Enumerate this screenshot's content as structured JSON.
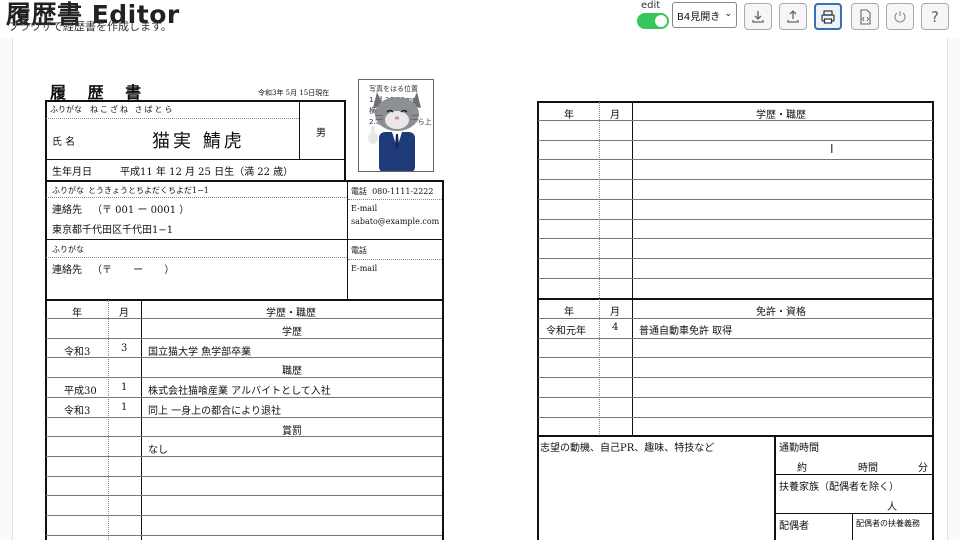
{
  "app": {
    "title": "履歴書 Editor",
    "subtitle": "ブラウザで経歴書を作成します。"
  },
  "toolbar": {
    "edit_label": "edit",
    "edit_on": true,
    "layout_select": "B4見開き",
    "buttons": [
      {
        "name": "download-icon"
      },
      {
        "name": "upload-icon"
      },
      {
        "name": "print-icon"
      },
      {
        "name": "html-code-icon"
      },
      {
        "name": "power-icon"
      },
      {
        "name": "help-icon",
        "label": "?"
      }
    ]
  },
  "resume": {
    "title": "履 歴 書",
    "date": "令和3年 5月 15日現在",
    "photo_text": [
      "写真をはる位置",
      "1.縦 36-40mm",
      "横 24-30mm",
      "2.本人単身胸から上"
    ],
    "furigana_label": "ふりがな",
    "name_furigana": "ねこざね さばとら",
    "name_label": "氏 名",
    "name": "猫実 鯖虎",
    "gender": "男",
    "birth_label": "生年月日",
    "birth": "平成11 年 12 月 25 日生（満 22 歳）",
    "address_furigana": "とうきょうとちよだくちよだ1−1",
    "contact_label": "連絡先",
    "postal": "（〒 001 ー 0001 ）",
    "address": "東京都千代田区千代田1−1",
    "phone_label": "電話",
    "phone": "080-1111-2222",
    "email_label": "E-mail",
    "email": "sabato@example.com",
    "postal2": "（〒 ー ）",
    "col_year": "年",
    "col_month": "月",
    "col_history": "学歴・職歴",
    "history_rows": [
      {
        "year": "",
        "month": "",
        "text": "学歴",
        "center": true
      },
      {
        "year": "令和3",
        "month": "3",
        "text": "国立猫大学 魚学部卒業",
        "center": false
      },
      {
        "year": "",
        "month": "",
        "text": "職歴",
        "center": true
      },
      {
        "year": "平成30",
        "month": "1",
        "text": "株式会社猫喰産業 アルバイトとして入社",
        "center": false
      },
      {
        "year": "令和3",
        "month": "1",
        "text": "同上 一身上の都合により退社",
        "center": false
      },
      {
        "year": "",
        "month": "",
        "text": "賞罰",
        "center": true
      },
      {
        "year": "",
        "month": "",
        "text": "なし",
        "center": false
      }
    ],
    "col_license": "免許・資格",
    "license_rows": [
      {
        "year": "令和元年",
        "month": "4",
        "text": "普通自動車免許 取得"
      }
    ],
    "motivation_label": "志望の動機、自己PR、趣味、特技など",
    "commute_label": "通勤時間",
    "commute_value": "約 時間 分",
    "commute_approx": "約",
    "commute_hours": "時間",
    "commute_minutes": "分",
    "dependents_label": "扶養家族（配偶者を除く）",
    "dependents_unit": "人",
    "spouse_label": "配偶者",
    "spouse_support_label": "配偶者の扶養義務"
  }
}
